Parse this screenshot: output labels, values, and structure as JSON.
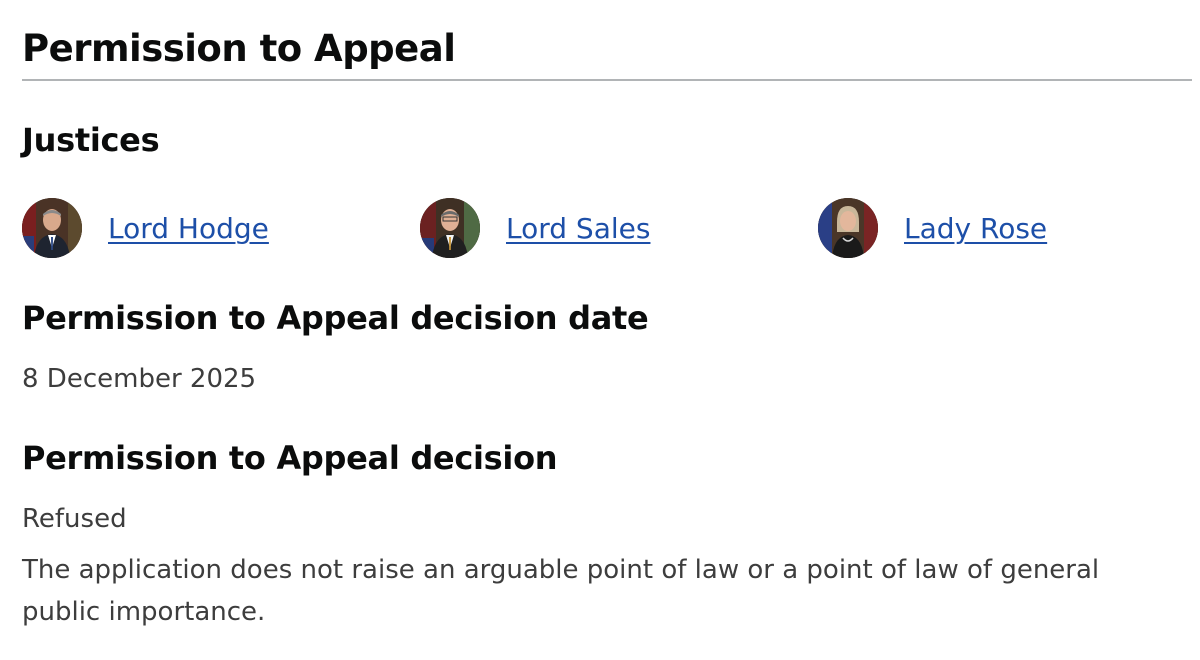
{
  "page_title": "Permission to Appeal",
  "justices": {
    "heading": "Justices",
    "items": [
      {
        "name": "Lord Hodge"
      },
      {
        "name": "Lord Sales"
      },
      {
        "name": "Lady Rose"
      }
    ]
  },
  "decision_date": {
    "heading": "Permission to Appeal decision date",
    "value": "8 December 2025"
  },
  "decision": {
    "heading": "Permission to Appeal decision",
    "outcome": "Refused",
    "reason": "The application does not raise an arguable point of law or a point of law of general public importance."
  },
  "colors": {
    "link": "#1d4fa8",
    "body_text": "#3d3d3d",
    "rule": "#b1b4b6"
  }
}
